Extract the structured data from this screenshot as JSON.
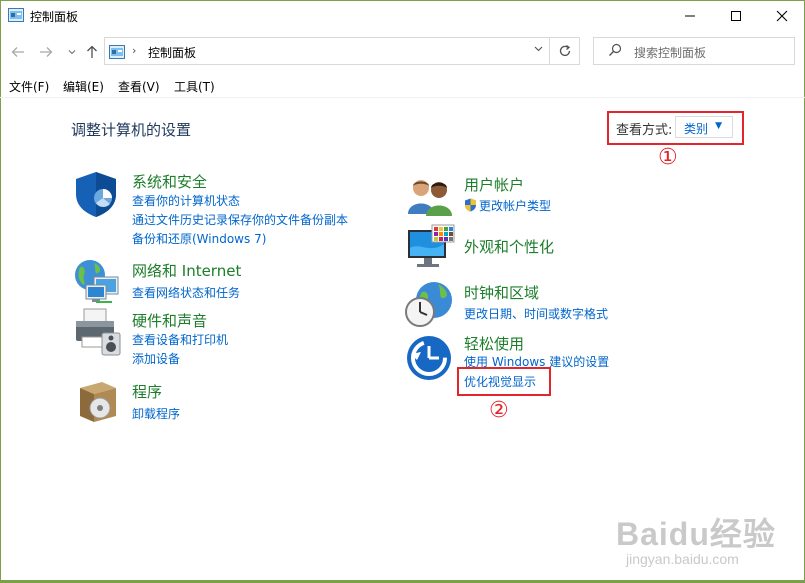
{
  "window": {
    "title": "控制面板",
    "minimize_glyph": "—",
    "maximize_glyph": "☐",
    "close_glyph": "✕"
  },
  "nav": {
    "back_icon": "arrow-left-icon",
    "forward_icon": "arrow-right-icon",
    "up_icon": "arrow-up-icon",
    "breadcrumb_separator": "›",
    "address": "控制面板",
    "refresh_icon": "refresh-icon",
    "search_placeholder": "搜索控制面板"
  },
  "menu": [
    "文件(F)",
    "编辑(E)",
    "查看(V)",
    "工具(T)"
  ],
  "main": {
    "title": "调整计算机的设置",
    "view_by_label": "查看方式:",
    "view_by_value": "类别"
  },
  "annotations": {
    "marker_1": "①",
    "marker_2": "②",
    "highlight_color": "#e3262b"
  },
  "categories_left": [
    {
      "icon": "security-shield-icon",
      "title": "系统和安全",
      "links": [
        "查看你的计算机状态",
        "通过文件历史记录保存你的文件备份副本",
        "备份和还原(Windows 7)"
      ]
    },
    {
      "icon": "network-globe-icon",
      "title": "网络和 Internet",
      "links": [
        "查看网络状态和任务"
      ]
    },
    {
      "icon": "printer-hardware-icon",
      "title": "硬件和声音",
      "links": [
        "查看设备和打印机",
        "添加设备"
      ]
    },
    {
      "icon": "programs-disc-icon",
      "title": "程序",
      "links": [
        "卸载程序"
      ]
    }
  ],
  "categories_right": [
    {
      "icon": "user-accounts-icon",
      "title": "用户帐户",
      "links": [
        "更改帐户类型"
      ]
    },
    {
      "icon": "appearance-monitor-icon",
      "title": "外观和个性化",
      "links": []
    },
    {
      "icon": "clock-globe-icon",
      "title": "时钟和区域",
      "links": [
        "更改日期、时间或数字格式"
      ]
    },
    {
      "icon": "ease-of-access-icon",
      "title": "轻松使用",
      "links": [
        "使用 Windows 建议的设置",
        "优化视觉显示"
      ]
    }
  ],
  "colors": {
    "heading_green": "#1c7d2a",
    "link_blue": "#0066cc",
    "title_navy": "#1e395b"
  },
  "watermark": {
    "logo": "Baidu经验",
    "url": "jingyan.baidu.com"
  }
}
